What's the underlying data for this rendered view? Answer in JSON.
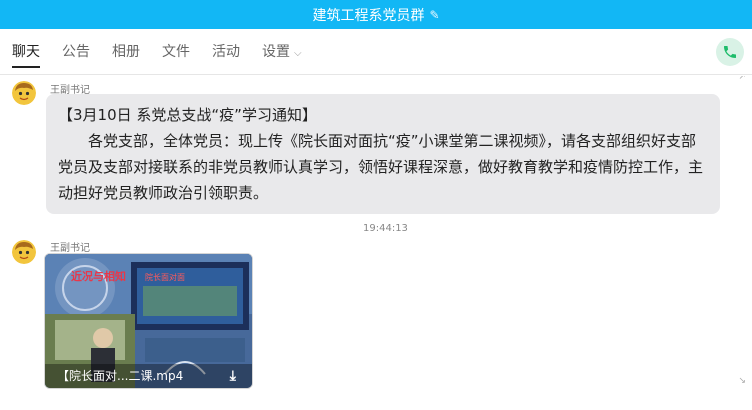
{
  "window": {
    "title": "建筑工程系党员群",
    "title_edit_icon": "pencil-icon"
  },
  "tabs": [
    {
      "label": "聊天",
      "active": true
    },
    {
      "label": "公告",
      "active": false
    },
    {
      "label": "相册",
      "active": false
    },
    {
      "label": "文件",
      "active": false
    },
    {
      "label": "活动",
      "active": false
    },
    {
      "label": "设置",
      "active": false,
      "dropdown": true
    }
  ],
  "call_button": {
    "icon": "phone-icon",
    "color": "#1ebc6b"
  },
  "messages": [
    {
      "sender": "王副书记",
      "avatar_icon": "emoji-avatar",
      "title": "【3月10日 系党总支战“疫”学习通知】",
      "body": "各党支部，全体党员：现上传《院长面对面抗“疫”小课堂第二课视频》，请各支部组织好支部党员及支部对接联系的非党员教师认真学习，领悟好课程深意，做好教育教学和疫情防控工作，主动担好党员教师政治引领职责。"
    },
    {
      "timestamp": "19:44:13",
      "sender": "王副书记",
      "avatar_icon": "emoji-avatar",
      "video": {
        "caption": "【院长面对...二课.mp4",
        "download_icon": "download-icon"
      }
    }
  ],
  "colors": {
    "titlebar": "#12b7f5",
    "bubble": "#e9e9eb"
  }
}
